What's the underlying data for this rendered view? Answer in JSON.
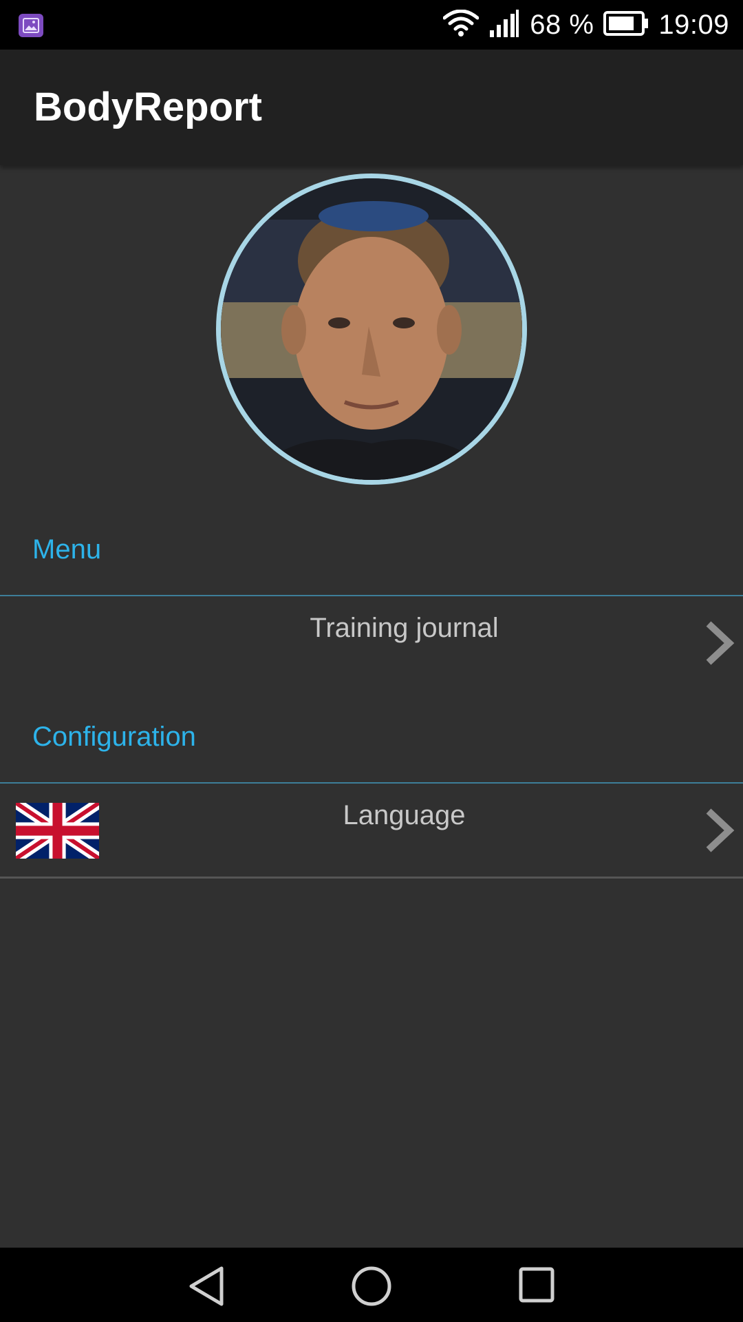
{
  "status_bar": {
    "battery_percent_text": "68 %",
    "time": "19:09",
    "icons": [
      "gallery-notification-icon",
      "wifi-icon",
      "signal-icon",
      "battery-icon"
    ]
  },
  "app_bar": {
    "title": "BodyReport"
  },
  "profile": {
    "avatar_icon": "user-photo"
  },
  "sections": {
    "menu_header": "Menu",
    "menu_items": [
      {
        "label": "Training journal",
        "icon": "chevron-right-icon"
      }
    ],
    "config_header": "Configuration",
    "config_items": [
      {
        "label": "Language",
        "icon": "uk-flag-icon"
      }
    ]
  },
  "nav_bar": {
    "buttons": [
      "back-icon",
      "home-icon",
      "recents-icon"
    ]
  },
  "colors": {
    "accent": "#2db3ea",
    "background": "#303030",
    "app_bar": "#212121",
    "avatar_border": "#a8d6e6"
  }
}
